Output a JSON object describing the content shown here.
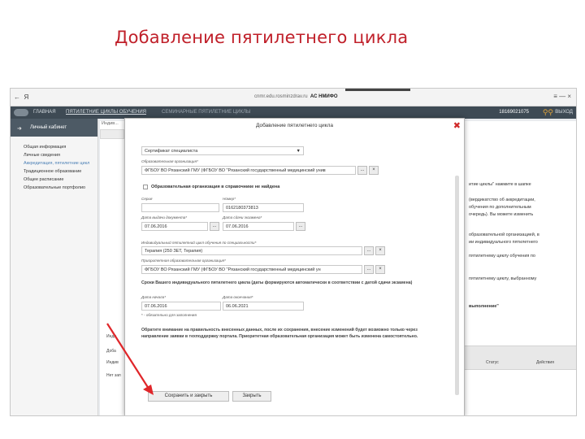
{
  "slide": {
    "title": "Добавление пятилетнего цикла"
  },
  "browser": {
    "back": "←",
    "letter": "Я",
    "url_host": "cnmr.edu.rosminzdrav.ru",
    "url_title": "АС НМИФО",
    "right_text": "≡ — ×"
  },
  "appnav": {
    "home": "ГЛАВНАЯ",
    "cycles": "ПЯТИЛЕТНИЕ ЦИКЛЫ ОБУЧЕНИЯ",
    "elements": "СЕМИНАРНЫЕ ПЯТИЛЕТНИЕ ЦИКЛЫ",
    "user": "18169021075",
    "exit": "ВЫХОД"
  },
  "sidebar": {
    "cabinet": "Личный кабинет",
    "items": [
      {
        "label": "Общая информация"
      },
      {
        "label": "Личные сведения"
      },
      {
        "label": "Аккредитация, пятилетние цикл"
      },
      {
        "label": "Традиционное образование"
      },
      {
        "label": "Общее расписание"
      },
      {
        "label": "Образовательные портфолио"
      }
    ]
  },
  "main": {
    "subtab": "Индив...",
    "right_lines": [
      "итие циклы\" нажмите в шапке",
      "(вердикатство об аккредитации,",
      "обучения по дополнительным",
      "очередь). Вы можете изменить",
      "образовательной организацией, в",
      "ии индивидуального пятилетнего",
      "пятилетнему циклу обучения по",
      "пятилетнему циклу, выбранному",
      "выполнение\""
    ],
    "left_tiny": [
      "Инди",
      "Доба",
      "Индив",
      "Нет зап"
    ],
    "table_cols": [
      "Статус",
      "Действия"
    ]
  },
  "modal": {
    "title": "Добавление пятилетнего цикла",
    "close": "✖",
    "doc_type": "Сертификат специалиста",
    "org_label": "Образовательная организация*",
    "org_value": "ФГБОУ ВО Рязанский ГМУ (ФГБОУ ВО \"Рязанский государственный медицинский унив",
    "not_found_label": "Образовательная организация в справочнике не найдена",
    "series_label": "Серия",
    "number_label": "Номер*",
    "number_value": "0162180373813",
    "issue_label": "Дата выдачи документа*",
    "issue_value": "07.06.2016",
    "exam_label": "Дата сдачи экзамена*",
    "exam_value": "07.06.2016",
    "cycle_label": "Индивидуальный пятилетний цикл обучения по специальности*",
    "cycle_value": "Терапия (250 ЗЕТ, Терапия)",
    "prio_label": "Приоритетная образовательная организация*",
    "prio_value": "ФГБОУ ВО Рязанский ГМУ (ФГБОУ ВО \"Рязанский государственный медицинский ун",
    "terms_heading": "Сроки Вашего индивидуального пятилетнего цикла (даты формируются автоматически в соответствии с датой сдачи экзамена)",
    "start_label": "Дата начала*",
    "start_value": "07.06.2016",
    "end_label": "Дата окончания*",
    "end_value": "06.06.2021",
    "required_note": "* - обязательно для заполнения",
    "warning": "Обратите внимание на правильность внесенных данных, после их сохранения, внесение изменений будет возможно только через направление заявки в техподдержку портала. Приоритетная образовательная организация может быть изменена самостоятельно.",
    "save_button": "Сохранить и закрыть",
    "close_button": "Закрыть",
    "ellipsis": "...",
    "clear": "×",
    "dropdown_arrow": "▼"
  },
  "colors": {
    "slide_title": "#c0202a",
    "arrow": "#e0262a",
    "close_x": "#d02a2a"
  }
}
